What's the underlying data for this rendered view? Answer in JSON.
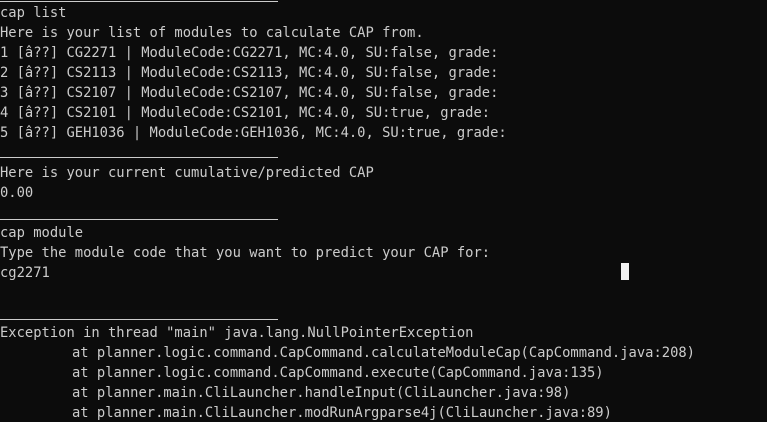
{
  "terminal": {
    "lines": [
      "cap list",
      "Here is your list of modules to calculate CAP from.",
      "1 [â??] CG2271 | ModuleCode:CG2271, MC:4.0, SU:false, grade:",
      "2 [â??] CS2113 | ModuleCode:CS2113, MC:4.0, SU:false, grade:",
      "3 [â??] CS2107 | ModuleCode:CS2107, MC:4.0, SU:false, grade:",
      "4 [â??] CS2101 | ModuleCode:CS2101, MC:4.0, SU:true, grade:",
      "5 [â??] GEH1036 | ModuleCode:GEH1036, MC:4.0, SU:true, grade:",
      "Here is your current cumulative/predicted CAP",
      "0.00",
      "cap module",
      "Type the module code that you want to predict your CAP for:",
      "cg2271",
      "Exception in thread \"main\" java.lang.NullPointerException",
      "at planner.logic.command.CapCommand.calculateModuleCap(CapCommand.java:208)",
      "at planner.logic.command.CapCommand.execute(CapCommand.java:135)",
      "at planner.main.CliLauncher.handleInput(CliLauncher.java:98)",
      "at planner.main.CliLauncher.modRunArgparse4j(CliLauncher.java:89)"
    ]
  },
  "colors": {
    "background": "#0c0c0c",
    "text": "#cccccc",
    "cursor": "#f2f2f2"
  }
}
